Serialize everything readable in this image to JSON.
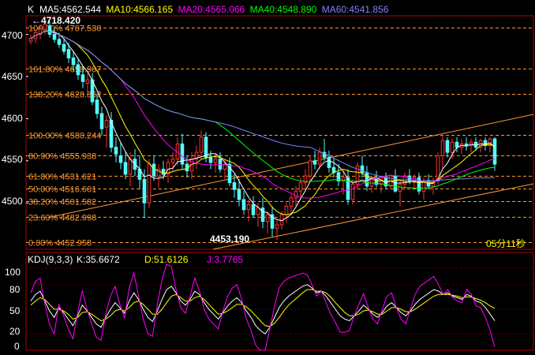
{
  "main_panel": {
    "symbol": "K",
    "ma_labels": [
      {
        "text": "MA5:4562.544",
        "color": "#ffffff"
      },
      {
        "text": "MA10:4566.165",
        "color": "#ffff00"
      },
      {
        "text": "MA20:4565.066",
        "color": "#ff00ff"
      },
      {
        "text": "MA40:4548.890",
        "color": "#00ff00"
      },
      {
        "text": "MA60:4541.856",
        "color": "#8080ff"
      }
    ],
    "high_marker": "4718.420",
    "low_marker": "4453.190",
    "timer": "05分11秒",
    "price_axis": [
      "4700",
      "4650",
      "4600",
      "4550",
      "4500"
    ],
    "fib_levels": [
      {
        "label": "100.00% 4707.530",
        "price": 4707.53
      },
      {
        "label": "161.80% 4658.907",
        "price": 4658.907
      },
      {
        "label": "138.20% 4628.867",
        "price": 4628.867
      },
      {
        "label": "100.00% 4580.244",
        "price": 4580.244
      },
      {
        "label": "80.90% 4555.938",
        "price": 4555.938
      },
      {
        "label": "61.80% 4531.621",
        "price": 4531.621
      },
      {
        "label": "50.00% 4516.601",
        "price": 4516.601
      },
      {
        "label": "38.20% 4501.582",
        "price": 4501.582
      },
      {
        "label": "23.60% 4482.998",
        "price": 4482.998
      },
      {
        "label": "0.00% 4452.958",
        "price": 4452.958
      }
    ]
  },
  "kdj_panel": {
    "title": "KDJ(9,3,3)",
    "k_label": "K:35.6672",
    "d_label": "D:51.6126",
    "j_label": "J:3.7765",
    "axis": [
      "100",
      "80",
      "50",
      "20",
      "0"
    ]
  },
  "colors": {
    "background": "#000000",
    "up": "#ff3232",
    "down": "#54fcfc",
    "grid": "#b00000",
    "fib": "#ff9933",
    "k_line": "#ffffff",
    "d_line": "#ffff00",
    "j_line": "#ff00ff"
  },
  "chart_data": {
    "type": "candlestick",
    "y_range": [
      4445,
      4722
    ],
    "candles_ohlc": [
      [
        4692,
        4700,
        4688,
        4695
      ],
      [
        4695,
        4706,
        4690,
        4702
      ],
      [
        4700,
        4712,
        4694,
        4706
      ],
      [
        4706,
        4718,
        4700,
        4712
      ],
      [
        4710,
        4716,
        4696,
        4700
      ],
      [
        4700,
        4706,
        4690,
        4694
      ],
      [
        4694,
        4702,
        4684,
        4688
      ],
      [
        4688,
        4694,
        4676,
        4680
      ],
      [
        4682,
        4690,
        4666,
        4672
      ],
      [
        4672,
        4680,
        4656,
        4664
      ],
      [
        4664,
        4672,
        4646,
        4652
      ],
      [
        4652,
        4662,
        4636,
        4644
      ],
      [
        4642,
        4654,
        4628,
        4646
      ],
      [
        4646,
        4654,
        4616,
        4620
      ],
      [
        4622,
        4630,
        4600,
        4606
      ],
      [
        4606,
        4614,
        4580,
        4588
      ],
      [
        4590,
        4604,
        4566,
        4598
      ],
      [
        4598,
        4608,
        4560,
        4566
      ],
      [
        4566,
        4578,
        4548,
        4558
      ],
      [
        4556,
        4572,
        4540,
        4548
      ],
      [
        4548,
        4560,
        4528,
        4534
      ],
      [
        4534,
        4560,
        4520,
        4552
      ],
      [
        4552,
        4564,
        4532,
        4540
      ],
      [
        4540,
        4556,
        4516,
        4528
      ],
      [
        4528,
        4540,
        4482,
        4500
      ],
      [
        4500,
        4552,
        4494,
        4546
      ],
      [
        4546,
        4556,
        4526,
        4532
      ],
      [
        4532,
        4546,
        4518,
        4540
      ],
      [
        4540,
        4550,
        4528,
        4534
      ],
      [
        4534,
        4552,
        4524,
        4548
      ],
      [
        4548,
        4560,
        4538,
        4552
      ],
      [
        4552,
        4578,
        4544,
        4570
      ],
      [
        4570,
        4582,
        4540,
        4546
      ],
      [
        4546,
        4556,
        4530,
        4538
      ],
      [
        4538,
        4560,
        4528,
        4552
      ],
      [
        4552,
        4568,
        4540,
        4560
      ],
      [
        4560,
        4586,
        4552,
        4578
      ],
      [
        4578,
        4584,
        4548,
        4554
      ],
      [
        4554,
        4562,
        4540,
        4548
      ],
      [
        4548,
        4558,
        4536,
        4552
      ],
      [
        4552,
        4560,
        4536,
        4540
      ],
      [
        4540,
        4552,
        4528,
        4546
      ],
      [
        4546,
        4554,
        4520,
        4524
      ],
      [
        4524,
        4534,
        4506,
        4516
      ],
      [
        4516,
        4528,
        4496,
        4504
      ],
      [
        4504,
        4514,
        4486,
        4492
      ],
      [
        4492,
        4504,
        4478,
        4498
      ],
      [
        4498,
        4508,
        4482,
        4486
      ],
      [
        4486,
        4500,
        4472,
        4494
      ],
      [
        4494,
        4506,
        4470,
        4478
      ],
      [
        4478,
        4490,
        4464,
        4486
      ],
      [
        4486,
        4496,
        4460,
        4470
      ],
      [
        4470,
        4480,
        4456,
        4474
      ],
      [
        4474,
        4490,
        4468,
        4486
      ],
      [
        4486,
        4500,
        4476,
        4496
      ],
      [
        4496,
        4510,
        4486,
        4506
      ],
      [
        4506,
        4520,
        4496,
        4514
      ],
      [
        4514,
        4530,
        4504,
        4524
      ],
      [
        4524,
        4540,
        4514,
        4532
      ],
      [
        4532,
        4556,
        4526,
        4550
      ],
      [
        4550,
        4562,
        4540,
        4546
      ],
      [
        4546,
        4566,
        4540,
        4560
      ],
      [
        4560,
        4576,
        4550,
        4554
      ],
      [
        4554,
        4562,
        4536,
        4542
      ],
      [
        4542,
        4554,
        4530,
        4536
      ],
      [
        4536,
        4546,
        4520,
        4526
      ],
      [
        4526,
        4538,
        4510,
        4530
      ],
      [
        4530,
        4540,
        4498,
        4504
      ],
      [
        4504,
        4528,
        4498,
        4522
      ],
      [
        4522,
        4548,
        4516,
        4544
      ],
      [
        4544,
        4556,
        4530,
        4536
      ],
      [
        4536,
        4544,
        4514,
        4520
      ],
      [
        4520,
        4532,
        4512,
        4528
      ],
      [
        4528,
        4538,
        4518,
        4522
      ],
      [
        4522,
        4532,
        4512,
        4530
      ],
      [
        4530,
        4536,
        4516,
        4520
      ],
      [
        4520,
        4534,
        4516,
        4532
      ],
      [
        4532,
        4540,
        4512,
        4514
      ],
      [
        4514,
        4526,
        4496,
        4522
      ],
      [
        4522,
        4536,
        4516,
        4532
      ],
      [
        4532,
        4540,
        4522,
        4526
      ],
      [
        4526,
        4534,
        4518,
        4530
      ],
      [
        4530,
        4536,
        4510,
        4514
      ],
      [
        4514,
        4530,
        4504,
        4526
      ],
      [
        4526,
        4534,
        4516,
        4520
      ],
      [
        4520,
        4530,
        4510,
        4526
      ],
      [
        4526,
        4560,
        4522,
        4556
      ],
      [
        4556,
        4580,
        4540,
        4574
      ],
      [
        4574,
        4578,
        4554,
        4560
      ],
      [
        4560,
        4576,
        4552,
        4572
      ],
      [
        4572,
        4578,
        4560,
        4566
      ],
      [
        4566,
        4576,
        4558,
        4570
      ],
      [
        4570,
        4578,
        4562,
        4568
      ],
      [
        4568,
        4576,
        4560,
        4572
      ],
      [
        4572,
        4578,
        4562,
        4566
      ],
      [
        4566,
        4576,
        4560,
        4574
      ],
      [
        4574,
        4578,
        4562,
        4568
      ],
      [
        4568,
        4578,
        4560,
        4576
      ],
      [
        4576,
        4578,
        4538,
        4546
      ]
    ],
    "kdj_k": [
      60,
      68,
      72,
      60,
      48,
      40,
      52,
      46,
      38,
      30,
      42,
      55,
      48,
      40,
      32,
      28,
      40,
      50,
      58,
      52,
      45,
      60,
      70,
      62,
      50,
      40,
      35,
      48,
      62,
      74,
      78,
      70,
      60,
      55,
      62,
      72,
      68,
      58,
      50,
      44,
      38,
      46,
      54,
      60,
      64,
      58,
      48,
      40,
      30,
      24,
      20,
      28,
      40,
      52,
      60,
      66,
      70,
      74,
      78,
      80,
      76,
      70,
      72,
      66,
      58,
      50,
      42,
      38,
      36,
      42,
      48,
      55,
      50,
      44,
      40,
      46,
      54,
      58,
      52,
      46,
      42,
      48,
      56,
      62,
      66,
      70,
      74,
      72,
      68,
      70,
      66,
      64,
      62,
      68,
      66,
      60,
      58,
      52,
      44,
      36
    ],
    "kdj_d": [
      55,
      60,
      64,
      62,
      56,
      50,
      50,
      48,
      44,
      38,
      40,
      46,
      47,
      44,
      40,
      36,
      38,
      42,
      48,
      50,
      48,
      52,
      58,
      60,
      56,
      50,
      44,
      44,
      50,
      58,
      66,
      68,
      64,
      60,
      60,
      64,
      66,
      62,
      56,
      50,
      44,
      45,
      48,
      52,
      56,
      56,
      53,
      48,
      42,
      36,
      30,
      29,
      33,
      40,
      48,
      55,
      60,
      65,
      70,
      74,
      74,
      72,
      72,
      70,
      65,
      58,
      52,
      46,
      42,
      42,
      44,
      48,
      49,
      47,
      44,
      44,
      48,
      52,
      52,
      50,
      47,
      47,
      50,
      54,
      58,
      62,
      66,
      68,
      68,
      68,
      67,
      66,
      64,
      65,
      65,
      63,
      61,
      58,
      54,
      51
    ],
    "kdj_j": [
      70,
      84,
      88,
      56,
      32,
      20,
      56,
      42,
      26,
      14,
      46,
      73,
      50,
      32,
      16,
      12,
      44,
      66,
      78,
      56,
      39,
      76,
      94,
      66,
      38,
      20,
      17,
      56,
      86,
      106,
      102,
      74,
      52,
      45,
      66,
      88,
      72,
      50,
      38,
      32,
      26,
      48,
      66,
      76,
      80,
      62,
      38,
      24,
      6,
      0,
      0,
      26,
      54,
      76,
      84,
      88,
      90,
      92,
      94,
      92,
      80,
      66,
      72,
      58,
      44,
      34,
      22,
      22,
      24,
      42,
      56,
      69,
      52,
      38,
      32,
      50,
      66,
      70,
      52,
      38,
      32,
      50,
      68,
      78,
      82,
      86,
      90,
      80,
      68,
      74,
      64,
      60,
      58,
      74,
      68,
      54,
      52,
      40,
      24,
      4
    ]
  }
}
